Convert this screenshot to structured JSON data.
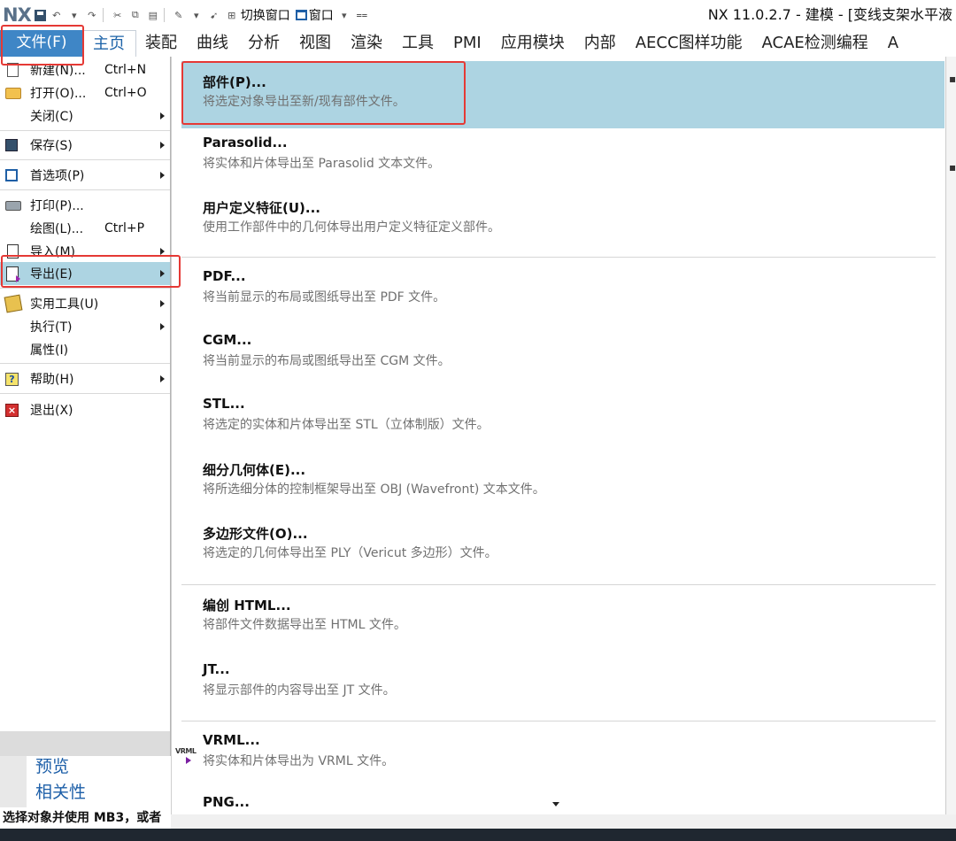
{
  "app": {
    "logo": "NX",
    "title": "NX 11.0.2.7 - 建模 - [变线支架水平液"
  },
  "quick_access": {
    "switch_window": "切换窗口",
    "window": "窗口"
  },
  "ribbon": {
    "file_tab": "文件(F)",
    "tabs": [
      "主页",
      "装配",
      "曲线",
      "分析",
      "视图",
      "渲染",
      "工具",
      "PMI",
      "应用模块",
      "内部",
      "AECC图样功能",
      "ACAE检测编程",
      "A"
    ]
  },
  "file_menu": {
    "items": [
      {
        "label": "新建(N)...",
        "shortcut": "Ctrl+N"
      },
      {
        "label": "打开(O)...",
        "shortcut": "Ctrl+O"
      },
      {
        "label": "关闭(C)"
      },
      {
        "label": "保存(S)"
      },
      {
        "label": "首选项(P)"
      },
      {
        "label": "打印(P)..."
      },
      {
        "label": "绘图(L)...",
        "shortcut": "Ctrl+P"
      },
      {
        "label": "导入(M)"
      },
      {
        "label": "导出(E)"
      },
      {
        "label": "实用工具(U)"
      },
      {
        "label": "执行(T)"
      },
      {
        "label": "属性(I)"
      },
      {
        "label": "帮助(H)"
      },
      {
        "label": "退出(X)"
      }
    ]
  },
  "export_menu": {
    "items": [
      {
        "title": "部件(P)...",
        "desc": "将选定对象导出至新/现有部件文件。"
      },
      {
        "title": "Parasolid...",
        "desc": "将实体和片体导出至 Parasolid 文本文件。"
      },
      {
        "title": "用户定义特征(U)...",
        "desc": "使用工作部件中的几何体导出用户定义特征定义部件。"
      },
      {
        "title": "PDF...",
        "desc": "将当前显示的布局或图纸导出至 PDF 文件。"
      },
      {
        "title": "CGM...",
        "desc": "将当前显示的布局或图纸导出至 CGM 文件。"
      },
      {
        "title": "STL...",
        "desc": "将选定的实体和片体导出至 STL（立体制版）文件。"
      },
      {
        "title": "细分几何体(E)...",
        "desc": "将所选细分体的控制框架导出至 OBJ (Wavefront) 文本文件。"
      },
      {
        "title": "多边形文件(O)...",
        "desc": "将选定的几何体导出至 PLY（Vericut 多边形）文件。"
      },
      {
        "title": "编创 HTML...",
        "desc": "将部件文件数据导出至 HTML 文件。"
      },
      {
        "title": "JT...",
        "desc": "将显示部件的内容导出至 JT 文件。"
      },
      {
        "title": "VRML...",
        "desc": "将实体和片体导出为 VRML 文件。"
      },
      {
        "title": "PNG..."
      }
    ],
    "vrml_icon_text": "VRML"
  },
  "navigator": {
    "preview": "预览",
    "relations": "相关性"
  },
  "status": "选择对象并使用 MB3，或者",
  "colors": {
    "file_tab": "#3f86c6",
    "highlight": "#add4e2",
    "annotation_red": "#e53935",
    "link_blue": "#1d5fa8"
  }
}
